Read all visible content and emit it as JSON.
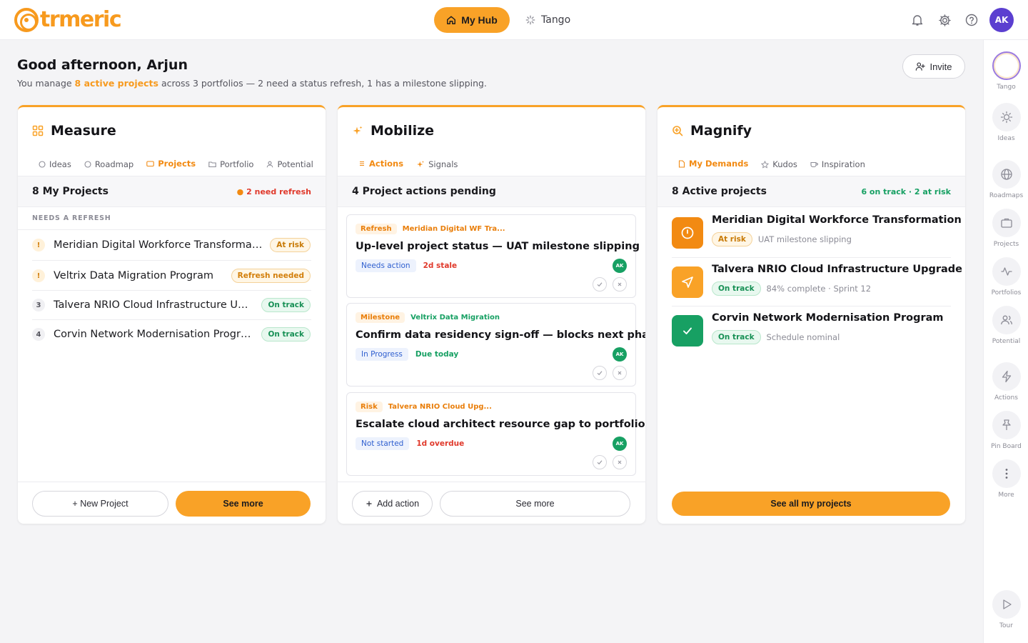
{
  "app": {
    "logo_text": "trmeric"
  },
  "topnav": {
    "hub_label": "My Hub",
    "tango_label": "Tango",
    "avatar_initials": "AK"
  },
  "header": {
    "greeting": "Good afternoon, Arjun",
    "subtitle_prefix": "You manage ",
    "subtitle_highlight": "8 active projects",
    "subtitle_suffix": " across 3 portfolios — 2 need a status refresh, 1 has a milestone slipping.",
    "invite_label": "Invite"
  },
  "rail": {
    "tango": "Tango",
    "ideas": "Ideas",
    "roadmaps": "Roadmaps",
    "projects": "Projects",
    "portfolios": "Portfolios",
    "potential": "Potential",
    "actions": "Actions",
    "pinboard": "Pin Board",
    "more": "More",
    "tour": "Tour"
  },
  "measure": {
    "title": "Measure",
    "tabs": [
      "Ideas",
      "Roadmap",
      "Projects",
      "Portfolio",
      "Potential"
    ],
    "band_title": "8  My Projects",
    "band_right": "2 need refresh",
    "section_label": "NEEDS A REFRESH",
    "rows": [
      {
        "idx": "!",
        "name": "Meridian Digital Workforce Transformation",
        "status": "At risk"
      },
      {
        "idx": "!",
        "name": "Veltrix Data Migration Program",
        "status": "Refresh needed"
      },
      {
        "idx": "3",
        "name": "Talvera NRIO Cloud Infrastructure Upgrade",
        "status": "On track"
      },
      {
        "idx": "4",
        "name": "Corvin Network Modernisation Program",
        "status": "On track"
      }
    ],
    "new_label": "+ New Project",
    "more_label": "See more"
  },
  "mobilize": {
    "title": "Mobilize",
    "tabs": [
      "Actions",
      "Signals"
    ],
    "band_title": "4  Project actions pending",
    "actions": [
      {
        "type": "Refresh",
        "project": "Meridian Digital WF Tra...",
        "title": "Up-level project status — UAT milestone slipping",
        "status": "Needs action",
        "note": "2d stale",
        "assignee": "AK"
      },
      {
        "type": "Milestone",
        "project": "Veltrix Data Migration",
        "title": "Confirm data residency sign-off — blocks next phase",
        "status": "In Progress",
        "note": "Due today",
        "assignee": "AK"
      },
      {
        "type": "Risk",
        "project": "Talvera NRIO Cloud Upg...",
        "title": "Escalate cloud architect resource gap to portfolio",
        "status": "Not started",
        "note": "1d overdue",
        "assignee": "AK"
      }
    ],
    "add_label": "Add action",
    "more_label": "See more"
  },
  "magnify": {
    "title": "Magnify",
    "tabs": [
      "My Demands",
      "Kudos",
      "Inspiration"
    ],
    "band_title": "8  Active projects",
    "band_right": "6 on track · 2 at risk",
    "rows": [
      {
        "name": "Meridian Digital Workforce Transformation",
        "status": "At risk",
        "note": "UAT milestone slipping"
      },
      {
        "name": "Talvera NRIO Cloud Infrastructure Upgrade",
        "status": "On track",
        "note": "84% complete · Sprint 12"
      },
      {
        "name": "Corvin Network Modernisation Program",
        "status": "On track",
        "note": "Schedule nominal"
      }
    ],
    "all_label": "See all my projects"
  },
  "colors": {
    "accent": "#f9a227",
    "success": "#17a063",
    "danger": "#e0392b",
    "link_blue": "#2f5fcf"
  }
}
